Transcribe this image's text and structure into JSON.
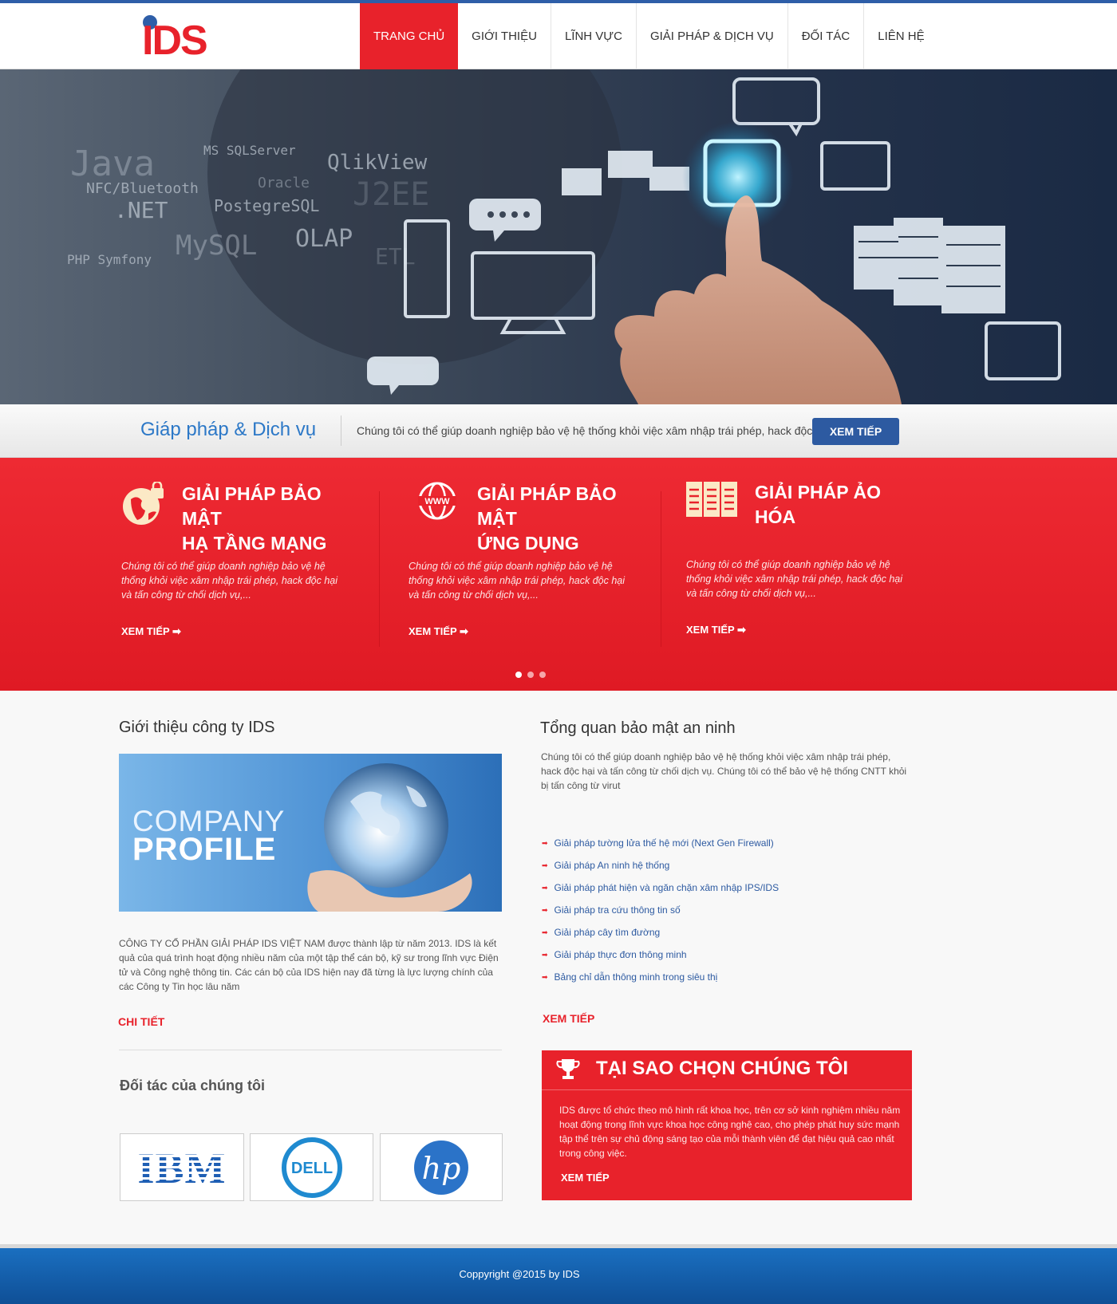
{
  "logo": {
    "text": "IDS"
  },
  "nav": {
    "items": [
      "TRANG CHỦ",
      "GIỚI THIỆU",
      "LĨNH VỰC",
      "GIẢI PHÁP & DỊCH VỤ",
      "ĐỐI TÁC",
      "LIÊN HỆ"
    ],
    "active": 0
  },
  "hero": {
    "tech_words": [
      "Java",
      "NFC/Bluetooth",
      ".NET",
      "MS SQLServer",
      "Oracle",
      "PostegreSQL",
      "QlikView",
      "J2EE",
      "MySQL",
      "OLAP",
      "ETL",
      "PHP Symfony"
    ],
    "slides": 5,
    "active_slide": 0
  },
  "strip": {
    "title": "Giáp pháp & Dịch vụ",
    "description": "Chúng tôi có thể giúp doanh nghiệp bảo vệ hệ thống khỏi việc xâm nhập trái phép, hack độc...",
    "button": "XEM TIẾP"
  },
  "services": {
    "items": [
      {
        "title_line1": "GIẢI PHÁP BẢO MẬT",
        "title_line2": "HẠ TẦNG MẠNG",
        "desc": "Chúng tôi có thể giúp doanh nghiệp bảo vệ hệ thống khỏi việc xâm nhập trái phép, hack độc hại và tấn công từ chối dịch vụ,...",
        "more": "XEM TIẾP ➡",
        "icon": "globe-lock-icon"
      },
      {
        "title_line1": "GIẢI PHÁP BẢO MẬT",
        "title_line2": "ỨNG DỤNG",
        "desc": "Chúng tôi có thể giúp doanh nghiệp bảo vệ hệ thống khỏi việc xâm nhập trái phép, hack độc hại và tấn công từ chối dịch vụ,...",
        "more": "XEM TIẾP ➡",
        "icon": "www-globe-icon"
      },
      {
        "title_line1": "GIẢI PHÁP ẢO",
        "title_line2": "HÓA",
        "desc": "Chúng tôi có thể giúp doanh nghiệp bảo vệ hệ thống khỏi việc xâm nhập trái phép, hack độc hại và tấn công từ chối dịch vụ,...",
        "more": "XEM TIẾP ➡",
        "icon": "documents-icon"
      }
    ],
    "pages": 3,
    "active_page": 0
  },
  "intro": {
    "heading": "Giới thiệu công ty IDS",
    "image_line1": "COMPANY",
    "image_line2": "PROFILE",
    "text": "CÔNG TY CỔ PHẦN GIẢI PHÁP IDS VIỆT NAM được thành lập từ năm 2013. IDS là kết quả của quá trình hoạt động nhiều năm của một tập thể cán bộ, kỹ sư trong lĩnh vực Điện tử và Công nghệ thông tin.  Các cán bộ của IDS hiện nay đã từng là lực lượng chính của các Công ty Tin học lâu năm",
    "link": "CHI TIẾT"
  },
  "overview": {
    "heading": "Tổng quan bảo mật an ninh",
    "text": "Chúng tôi có thể giúp doanh nghiệp bảo vệ hệ thống khỏi việc xâm nhập trái phép, hack độc hại và tấn công từ chối dịch vụ. Chúng tôi có thể bảo vệ hệ thống CNTT khỏi bị tấn công từ virut",
    "items": [
      "Giải pháp tường lửa thế hệ mới (Next Gen Firewall)",
      "Giải pháp An ninh hệ thống",
      "Giải pháp phát hiện và ngăn chặn xâm nhập IPS/IDS",
      "Giải pháp tra cứu thông tin số",
      "Giải pháp cây tìm đường",
      "Giải pháp thực đơn thông minh",
      "Bảng chỉ dẫn thông minh trong siêu thị"
    ],
    "link": "XEM TIẾP"
  },
  "partners": {
    "heading": "Đối tác của chúng tôi",
    "logos": [
      "IBM",
      "DELL",
      "hp"
    ]
  },
  "why": {
    "title": "TẠI SAO CHỌN CHÚNG TÔI",
    "text": "IDS được tổ chức theo mô hình rất khoa học, trên cơ sở kinh nghiệm nhiều năm hoạt động trong lĩnh vực khoa học công nghệ cao, cho phép phát huy sức mạnh tập thể trên sự chủ động sáng tạo của mỗi thành viên để đạt hiệu quả cao nhất trong công việc.",
    "link": "XEM TIẾP"
  },
  "footer": {
    "copyright": "Coppyright @2015 by IDS"
  },
  "colors": {
    "brand_red": "#e8222b",
    "brand_blue": "#2d5aa1",
    "heading_blue": "#2c78c7"
  }
}
